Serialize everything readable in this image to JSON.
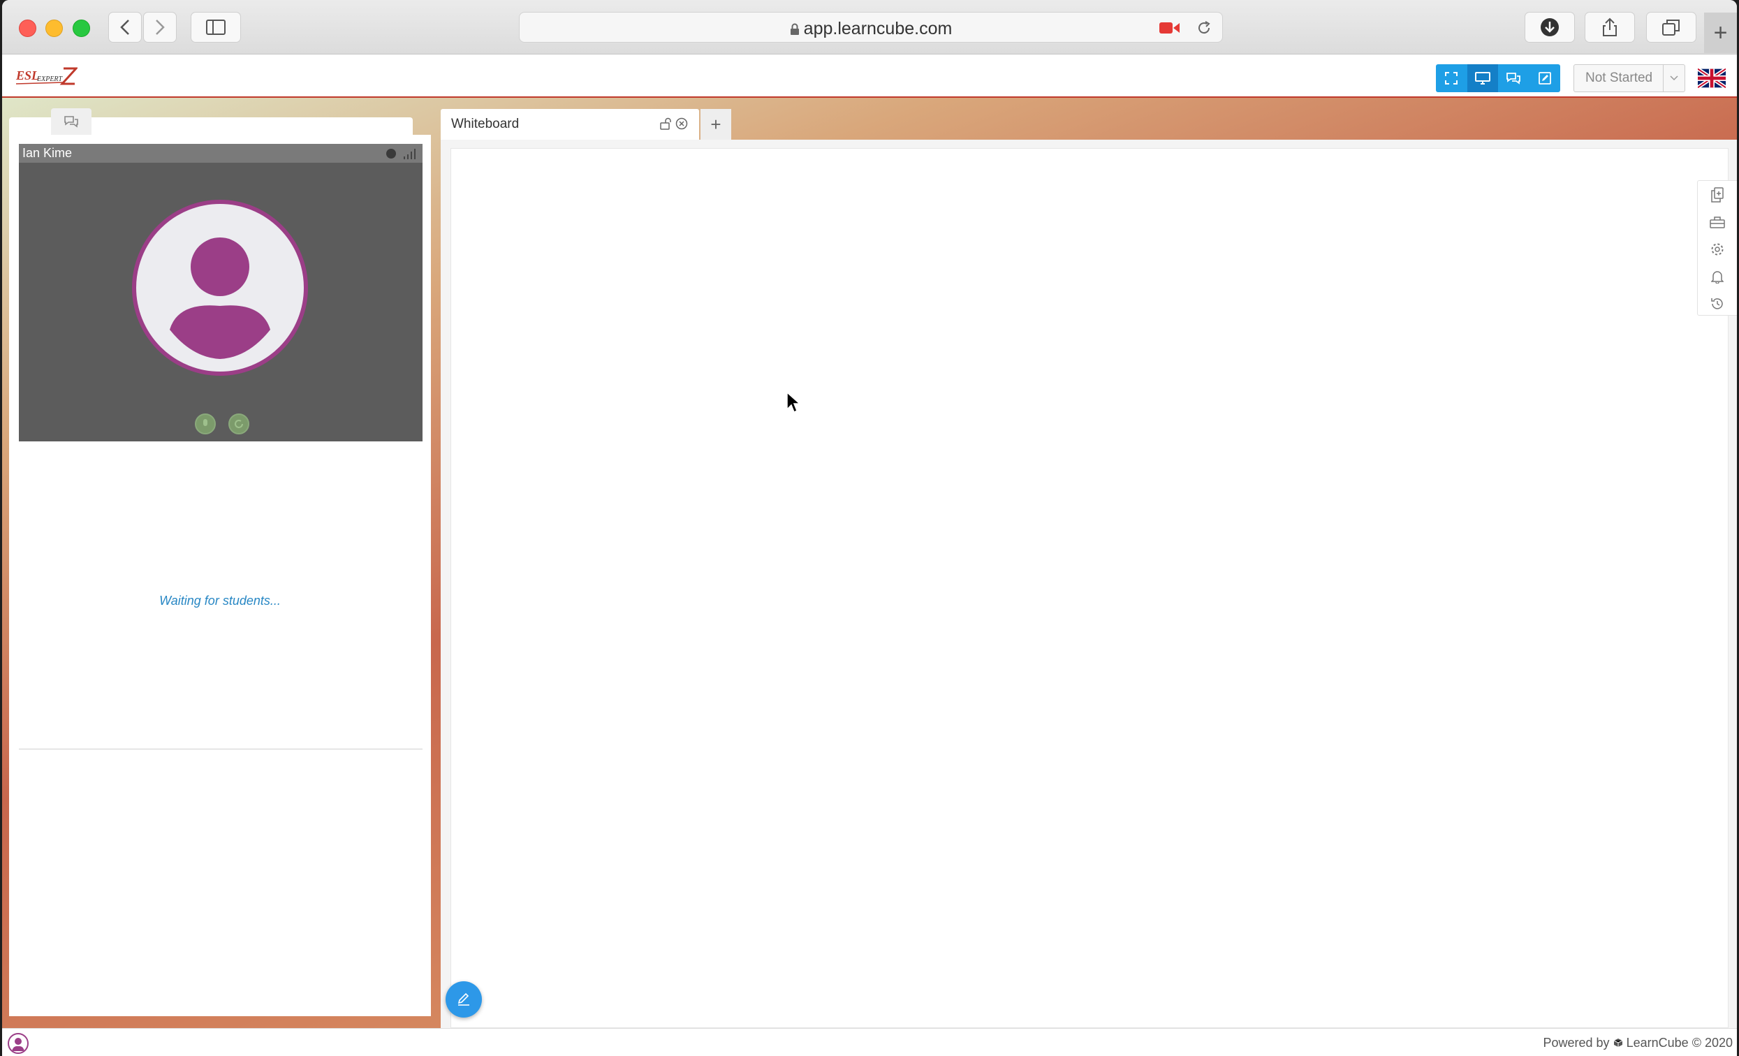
{
  "browser": {
    "url": "app.learncube.com",
    "new_tab_label": "+"
  },
  "app": {
    "logo": {
      "esl": "ESL",
      "expert": "EXPERT"
    },
    "class_status": "Not Started",
    "language_icon": "uk-flag-icon"
  },
  "left_panel": {
    "tabs": [
      {
        "icon": "video-camera-icon"
      },
      {
        "icon": "chat-bubbles-icon"
      }
    ],
    "participant_name": "Ian Kime",
    "waiting_text": "Waiting for students..."
  },
  "whiteboard": {
    "tab_label": "Whiteboard",
    "add_tab_label": "+",
    "side_tools": [
      "copy-icon",
      "toolbox-icon",
      "settings-icon",
      "bell-icon",
      "history-icon"
    ]
  },
  "footer": {
    "powered_by": "Powered by",
    "brand": "LearnCube",
    "copyright": "© 2020"
  },
  "colors": {
    "accent_blue": "#1e9fe6",
    "avatar_purple": "#9b3e87",
    "header_rule": "#c0392b",
    "waiting_text": "#2887c4"
  }
}
